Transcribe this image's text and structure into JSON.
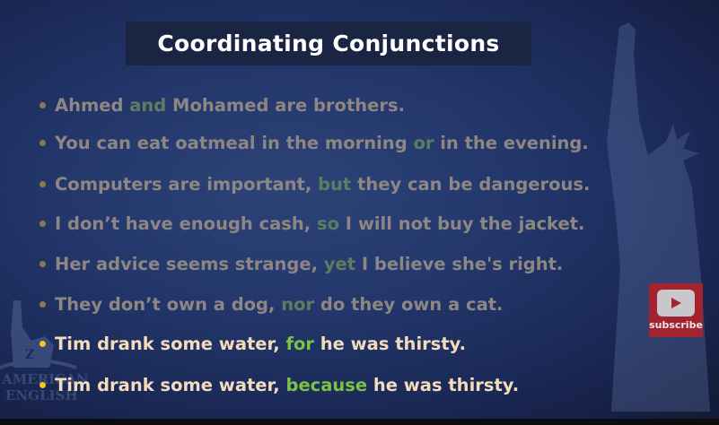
{
  "title": "Coordinating Conjunctions",
  "sentences": [
    {
      "before": "Ahmed ",
      "conj": "and",
      "after": " Mohamed are brothers.",
      "active": false
    },
    {
      "before": "You can eat oatmeal in the morning ",
      "conj": "or",
      "after": " in the evening.",
      "active": false
    },
    {
      "before": "Computers are important, ",
      "conj": "but",
      "after": " they can be dangerous.",
      "active": false
    },
    {
      "before": "I don’t have enough cash, ",
      "conj": "so",
      "after": " I will not buy the jacket.",
      "active": false
    },
    {
      "before": "Her advice seems strange, ",
      "conj": "yet",
      "after": " I believe she's right.",
      "active": false
    },
    {
      "before": "They don’t own a dog, ",
      "conj": "nor",
      "after": " do they own a cat.",
      "active": false
    },
    {
      "before": "Tim drank some water, ",
      "conj": "for",
      "after": " he was thirsty.",
      "active": true
    },
    {
      "before": "Tim drank some water, ",
      "conj": "because",
      "after": " he was thirsty.",
      "active": true
    }
  ],
  "subscribe": {
    "label": "subscribe",
    "icon": "youtube-play-icon"
  },
  "watermark": {
    "text": "AMERICAN ENGLISH",
    "letter": "Z"
  },
  "colors": {
    "conjunction_active": "#7cc243",
    "text_active": "#f3dcbc",
    "bullet_active": "#f5c518",
    "text_dim": "#8e8683"
  }
}
